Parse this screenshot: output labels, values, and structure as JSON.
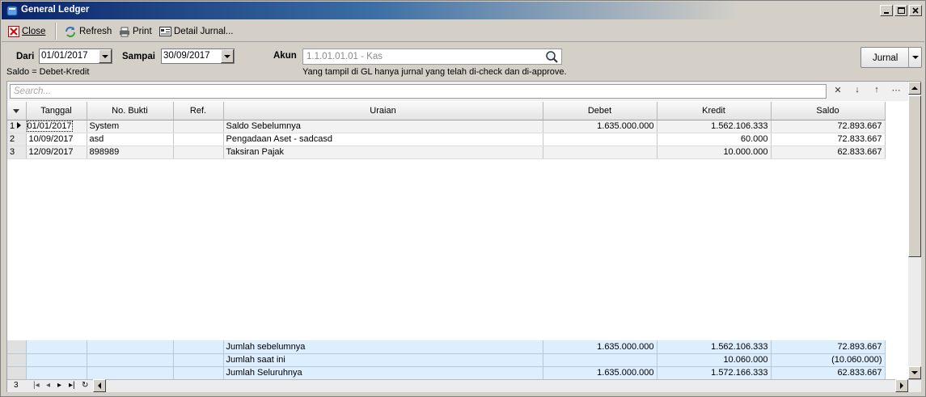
{
  "window": {
    "title": "General Ledger"
  },
  "toolbar": {
    "close": "Close",
    "refresh": "Refresh",
    "print": "Print",
    "detail": "Detail Jurnal..."
  },
  "filters": {
    "dari_label": "Dari",
    "dari_value": "01/01/2017",
    "sampai_label": "Sampai",
    "sampai_value": "30/09/2017",
    "akun_label": "Akun",
    "akun_value": "1.1.01.01.01 - Kas",
    "jurnal_button": "Jurnal",
    "saldo_note": "Saldo = Debet-Kredit",
    "info_note": "Yang tampil di GL hanya jurnal yang telah di-check dan di-approve."
  },
  "search": {
    "placeholder": "Search..."
  },
  "columns": [
    "Tanggal",
    "No. Bukti",
    "Ref.",
    "Uraian",
    "Debet",
    "Kredit",
    "Saldo"
  ],
  "rows": [
    {
      "n": "1",
      "tanggal": "01/01/2017",
      "bukti": "System",
      "ref": "",
      "uraian": "Saldo Sebelumnya",
      "debet": "1.635.000.000",
      "kredit": "1.562.106.333",
      "saldo": "72.893.667"
    },
    {
      "n": "2",
      "tanggal": "10/09/2017",
      "bukti": "asd",
      "ref": "",
      "uraian": "Pengadaan Aset - sadcasd",
      "debet": "",
      "kredit": "60.000",
      "saldo": "72.833.667"
    },
    {
      "n": "3",
      "tanggal": "12/09/2017",
      "bukti": "898989",
      "ref": "",
      "uraian": "Taksiran Pajak",
      "debet": "",
      "kredit": "10.000.000",
      "saldo": "62.833.667"
    }
  ],
  "summary": [
    {
      "label": "Jumlah sebelumnya",
      "debet": "1.635.000.000",
      "kredit": "1.562.106.333",
      "saldo": "72.893.667"
    },
    {
      "label": "Jumlah saat ini",
      "debet": "",
      "kredit": "10.060.000",
      "saldo": "(10.060.000)"
    },
    {
      "label": "Jumlah Seluruhnya",
      "debet": "1.635.000.000",
      "kredit": "1.572.166.333",
      "saldo": "62.833.667"
    }
  ],
  "navigator": {
    "record_count": "3"
  }
}
